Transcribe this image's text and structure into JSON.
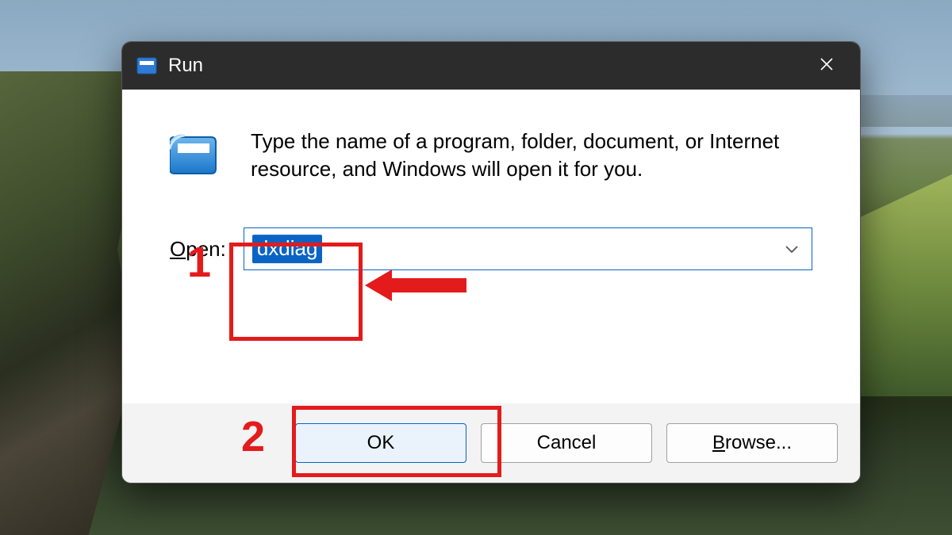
{
  "dialog": {
    "title": "Run",
    "description": "Type the name of a program, folder, document, or Internet resource, and Windows will open it for you.",
    "open_label_prefix": "O",
    "open_label_rest": "pen:",
    "input_value": "dxdiag",
    "buttons": {
      "ok": "OK",
      "cancel": "Cancel",
      "browse_prefix": "B",
      "browse_rest": "rowse..."
    }
  },
  "annotations": {
    "step1": "1",
    "step2": "2"
  }
}
